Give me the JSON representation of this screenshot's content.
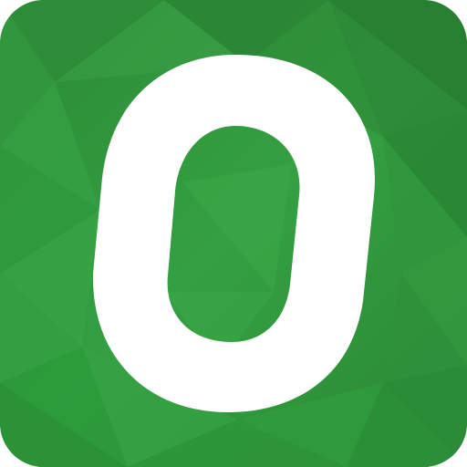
{
  "icon": {
    "name": "app-icon",
    "depicts": "stylized-letter-o-logo",
    "colors": {
      "background_base": "#2f8f3a",
      "background_light": "#3aa347",
      "background_dark": "#256f2e",
      "letter": "#ffffff"
    }
  }
}
